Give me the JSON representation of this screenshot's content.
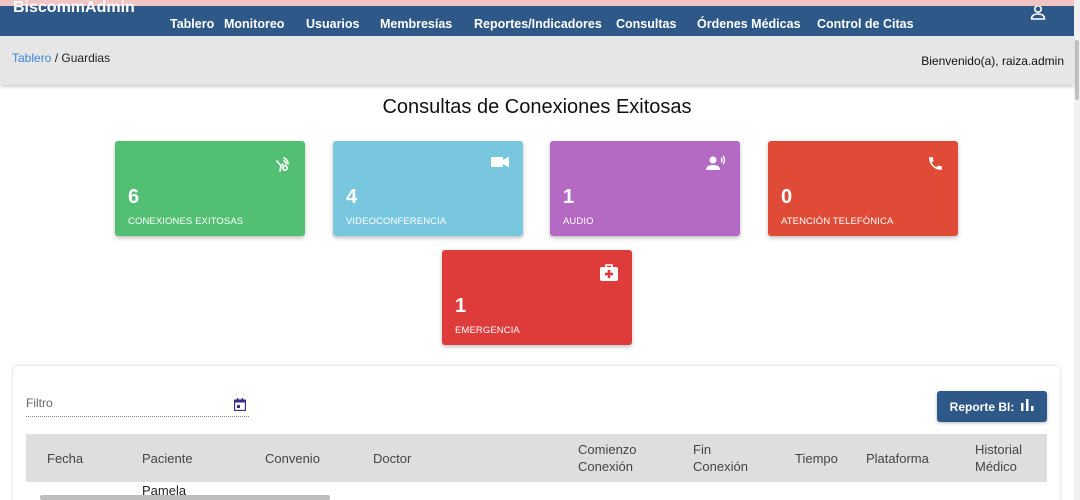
{
  "app": {
    "title": "BiscommAdmin"
  },
  "nav": {
    "items": [
      {
        "label": "Tablero"
      },
      {
        "label": "Monitoreo"
      },
      {
        "label": "Usuarios"
      },
      {
        "label": "Membresías"
      },
      {
        "label": "Reportes/Indicadores"
      },
      {
        "label": "Consultas"
      },
      {
        "label": "Órdenes Médicas"
      },
      {
        "label": "Control de Citas"
      }
    ]
  },
  "breadcrumb": {
    "root": "Tablero",
    "separator": "/",
    "current": "Guardias"
  },
  "welcome": "Bienvenido(a), raiza.admin",
  "page": {
    "title": "Consultas de Conexiones Exitosas"
  },
  "cards": [
    {
      "count": "6",
      "label": "CONEXIONES EXITOSAS",
      "color": "#52bf72",
      "icon": "touch-connect-icon"
    },
    {
      "count": "4",
      "label": "VIDEOCONFERENCIA",
      "color": "#79c6df",
      "icon": "videocam-icon"
    },
    {
      "count": "1",
      "label": "AUDIO",
      "color": "#b469c2",
      "icon": "voice-person-icon"
    },
    {
      "count": "0",
      "label": "ATENCIÓN TELEFÓNICA",
      "color": "#df4b36",
      "icon": "phone-icon"
    },
    {
      "count": "1",
      "label": "EMERGENCIA",
      "color": "#de3b3b",
      "icon": "medical-bag-icon"
    }
  ],
  "filter": {
    "placeholder": "Filtro"
  },
  "report_button": {
    "label": "Reporte BI:"
  },
  "table": {
    "headers": {
      "fecha": "Fecha",
      "paciente": "Paciente",
      "convenio": "Convenio",
      "doctor": "Doctor",
      "comienzo_1": "Comienzo",
      "comienzo_2": "Conexión",
      "fin_1": "Fin",
      "fin_2": "Conexión",
      "tiempo": "Tiempo",
      "plataforma": "Plataforma",
      "historial_1": "Historial",
      "historial_2": "Médico"
    },
    "rows": [
      {
        "paciente": "Pamela"
      }
    ]
  }
}
